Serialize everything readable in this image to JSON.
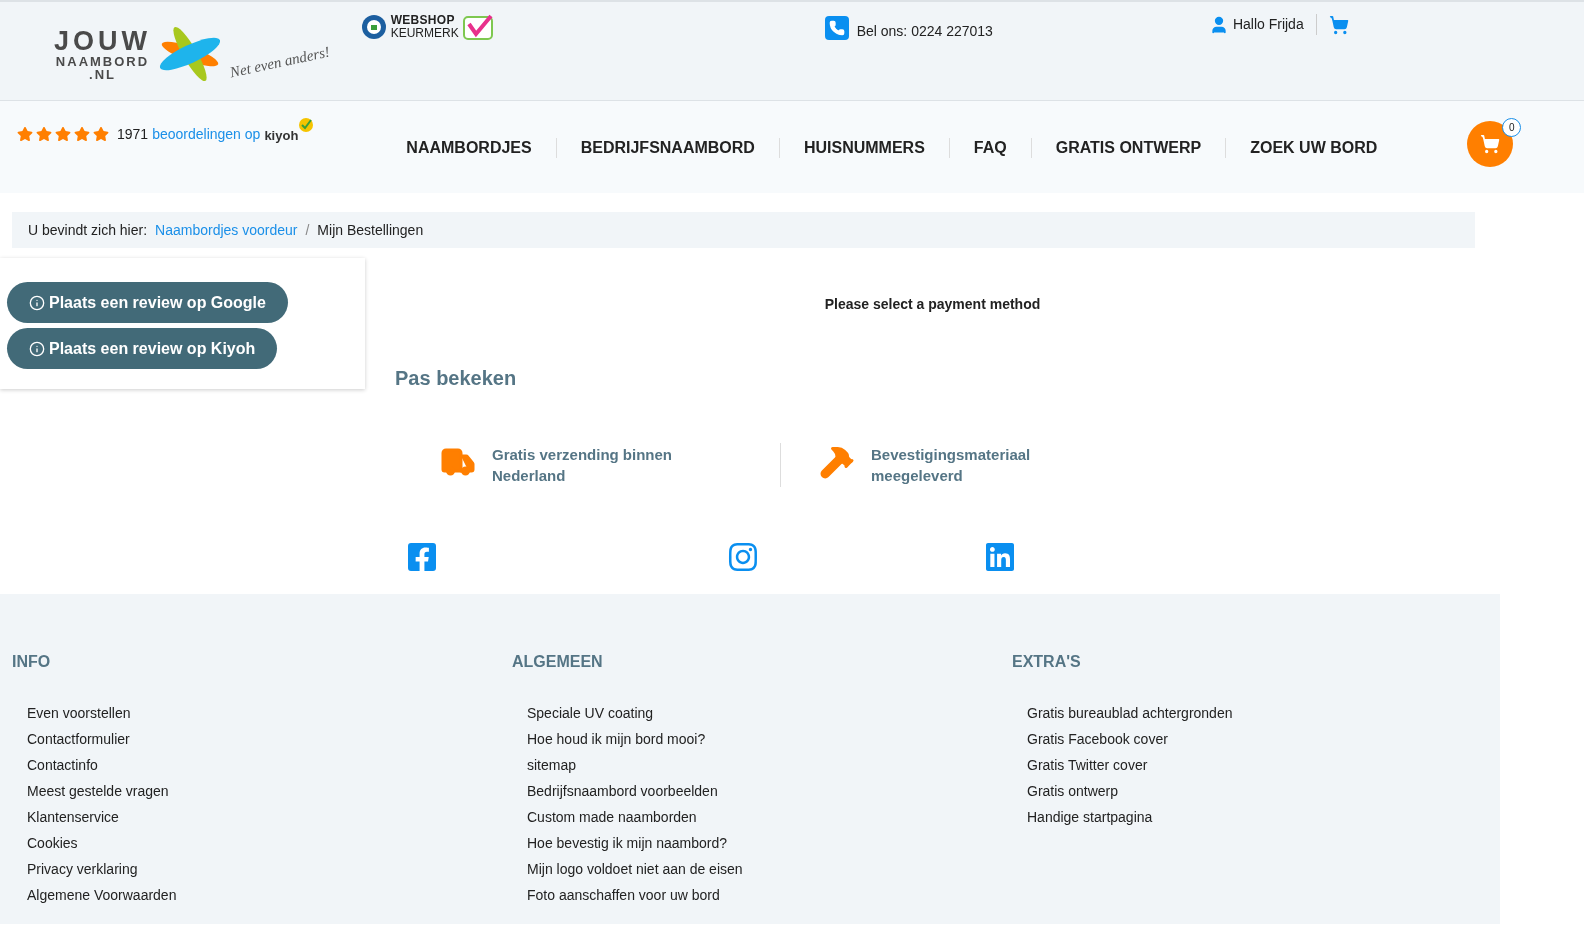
{
  "logo": {
    "line_1": "JOUW",
    "line_2": "NAAMBORD",
    "line_3": ".NL",
    "slogan": "Net even anders!"
  },
  "trust_badge": {
    "line_1": "WEBSHOP",
    "line_2": "KEURMERK"
  },
  "phone": "Bel ons: 0224 227013",
  "user_greeting": "Hallo Frijda",
  "rating": {
    "stars": 5,
    "count": "1971",
    "link": "beoordelingen op",
    "brand": "kiyoh"
  },
  "nav": [
    {
      "label": "NAAMBORDJES"
    },
    {
      "label": "BEDRIJFSNAAMBORD"
    },
    {
      "label": "HUISNUMMERS"
    },
    {
      "label": "FAQ"
    },
    {
      "label": "GRATIS ONTWERP"
    },
    {
      "label": "ZOEK UW BORD"
    }
  ],
  "cart_count": "0",
  "breadcrumb": {
    "prefix": "U bevindt zich hier:",
    "link": "Naambordjes voordeur",
    "separator": "/",
    "current": "Mijn Bestellingen"
  },
  "review_buttons": [
    "Plaats een review op Google",
    "Plaats een review op Kiyoh"
  ],
  "payment_message": "Please select a payment method",
  "recent_heading": "Pas bekeken",
  "features": [
    {
      "kind": "truck",
      "text": "Gratis verzending binnen Nederland"
    },
    {
      "kind": "hammer",
      "text": "Bevestigingsmateriaal meegeleverd"
    }
  ],
  "socials": [
    {
      "kind": "facebook"
    },
    {
      "kind": "instagram"
    },
    {
      "kind": "linkedin"
    }
  ],
  "footer": [
    {
      "heading": "INFO",
      "links": [
        "Even voorstellen",
        "Contactformulier",
        "Contactinfo",
        "Meest gestelde vragen",
        "Klantenservice",
        "Cookies",
        "Privacy verklaring",
        "Algemene Voorwaarden"
      ]
    },
    {
      "heading": "ALGEMEEN",
      "links": [
        "Speciale UV coating",
        "Hoe houd ik mijn bord mooi?",
        "sitemap",
        "Bedrijfsnaambord voorbeelden",
        "Custom made naamborden",
        "Hoe bevestig ik mijn naambord?",
        "Mijn logo voldoet niet aan de eisen",
        "Foto aanschaffen voor uw bord"
      ]
    },
    {
      "heading": "EXTRA'S",
      "links": [
        "Gratis bureaublad achtergronden",
        "Gratis Facebook cover",
        "Gratis Twitter cover",
        "Gratis ontwerp",
        "Handige startpagina"
      ]
    }
  ]
}
